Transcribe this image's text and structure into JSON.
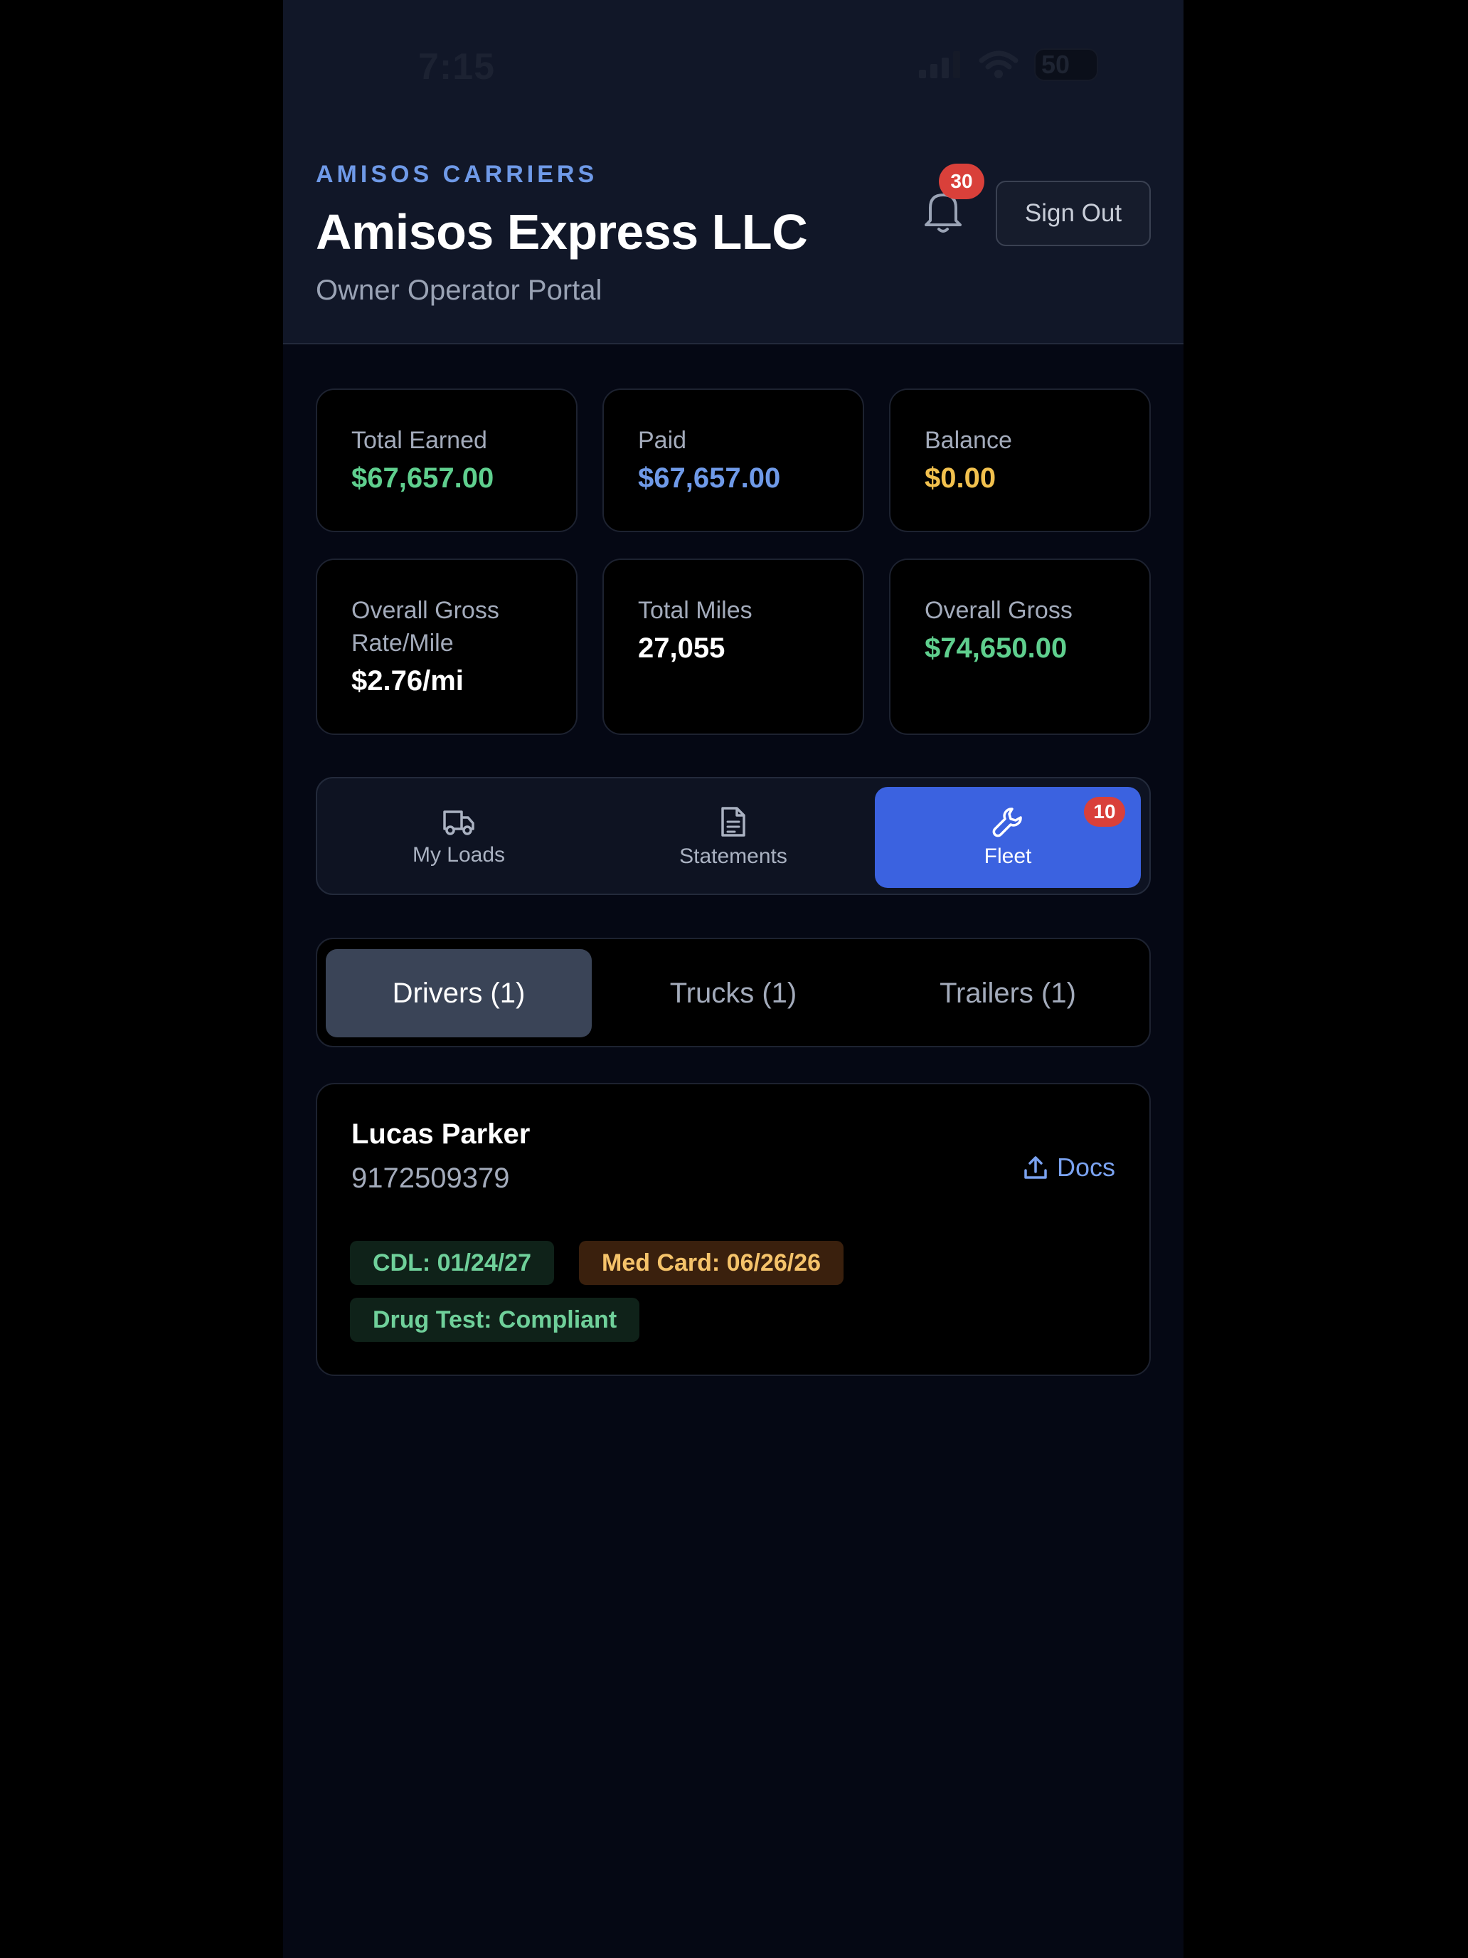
{
  "status_bar": {
    "time": "7:15",
    "battery": "50"
  },
  "header": {
    "kicker": "AMISOS CARRIERS",
    "title": "Amisos Express LLC",
    "subtitle": "Owner Operator Portal",
    "notification_count": "30",
    "signout_label": "Sign Out"
  },
  "stats": [
    {
      "label": "Total Earned",
      "value": "$67,657.00",
      "color": "#5fcf8e"
    },
    {
      "label": "Paid",
      "value": "$67,657.00",
      "color": "#6f9ae8"
    },
    {
      "label": "Balance",
      "value": "$0.00",
      "color": "#f2c14e"
    },
    {
      "label": "Overall Gross Rate/Mile",
      "value": "$2.76/mi",
      "color": "#ffffff"
    },
    {
      "label": "Total Miles",
      "value": "27,055",
      "color": "#ffffff"
    },
    {
      "label": "Overall Gross",
      "value": "$74,650.00",
      "color": "#5fcf8e"
    }
  ],
  "nav": {
    "items": [
      {
        "label": "My Loads",
        "icon": "truck-icon"
      },
      {
        "label": "Statements",
        "icon": "document-icon"
      },
      {
        "label": "Fleet",
        "icon": "wrench-icon",
        "badge": "10",
        "active": true
      }
    ]
  },
  "subtabs": [
    {
      "label": "Drivers (1)",
      "active": true
    },
    {
      "label": "Trucks (1)"
    },
    {
      "label": "Trailers (1)"
    }
  ],
  "driver": {
    "name": "Lucas Parker",
    "phone": "9172509379",
    "docs_label": "Docs",
    "badges": [
      {
        "text": "CDL: 01/24/27",
        "tone": "green"
      },
      {
        "text": "Med Card: 06/26/26",
        "tone": "amber"
      },
      {
        "text": "Drug Test: Compliant",
        "tone": "green"
      }
    ]
  },
  "colors": {
    "accent": "#3b62e0",
    "badge_red": "#d9403a",
    "background": "#050814"
  }
}
